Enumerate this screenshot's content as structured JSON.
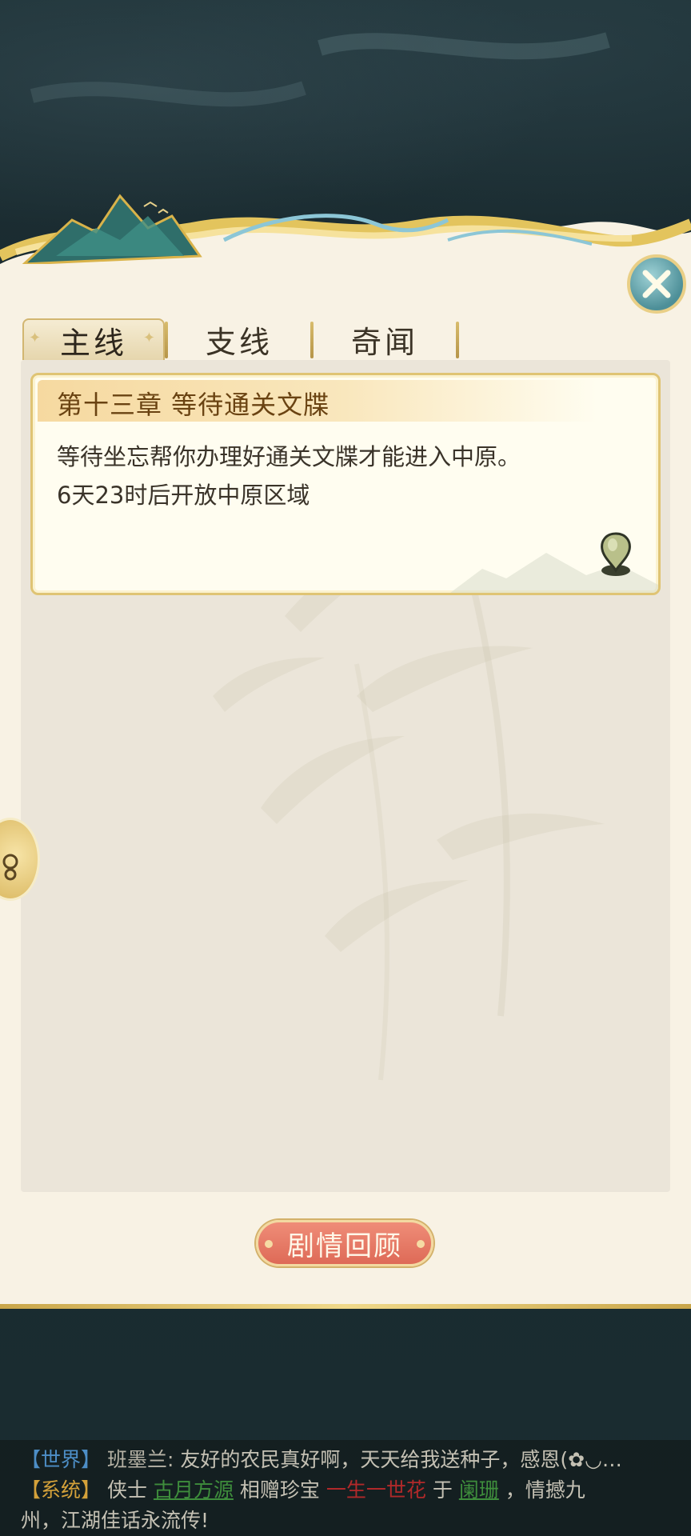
{
  "tabs": [
    {
      "label": "主线",
      "active": true
    },
    {
      "label": "支线",
      "active": false
    },
    {
      "label": "奇闻",
      "active": false
    }
  ],
  "quest": {
    "chapter_title": "第十三章 等待通关文牒",
    "description_line1": "等待坐忘帮你办理好通关文牒才能进入中原。",
    "description_line2": "6天23时后开放中原区域"
  },
  "buttons": {
    "review_label": "剧情回顾",
    "close_icon": "close-icon",
    "locate_icon": "map-pin-icon"
  },
  "chat": {
    "line1": {
      "channel": "【世界】",
      "speaker": "班墨兰:",
      "message": "友好的农民真好啊，天天给我送种子，感恩(✿◡…"
    },
    "line2": {
      "channel": "【系统】",
      "prefix": "侠士",
      "giver": "古月方源",
      "mid": "相赠珍宝",
      "gift": "一生一世花",
      "to": "于",
      "receiver": "阑珊",
      "suffix": "，情撼九"
    },
    "line3": "州，江湖佳话永流传!"
  },
  "colors": {
    "accent_gold": "#dfc474",
    "button_red": "#de6a57",
    "panel_bg": "#f8f2e4",
    "world_channel": "#4d8ec6",
    "system_channel": "#d4a13a"
  }
}
